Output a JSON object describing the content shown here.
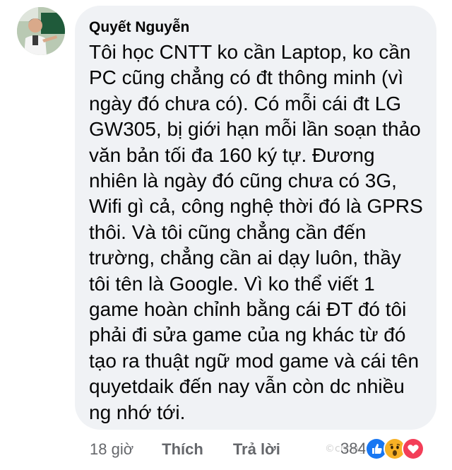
{
  "comment": {
    "author": "Quyết Nguyễn",
    "lines": [
      "Tôi học CNTT ko cần Laptop, ko cần",
      "PC cũng chẳng có đt thông minh (vì",
      "ngày đó chưa có). Có mỗi cái đt LG",
      "GW305, bị giới hạn mỗi lần soạn thảo",
      "văn bản tối đa 160 ký tự. Đương",
      "nhiên là ngày đó cũng chưa có 3G,",
      "Wifi gì cả, công nghệ thời đó là GPRS",
      "thôi. Và tôi cũng chẳng cần đến",
      "trường, chẳng cần ai dạy luôn, thầy",
      "tôi tên là Google. Vì ko thể viết 1",
      "game hoàn chỉnh bằng cái ĐT đó tôi",
      "phải đi sửa game của ng khác từ đó",
      "tạo ra thuật ngữ mod game và cái tên",
      "quyetdaik đến nay vẫn còn dc nhiều",
      "ng nhớ tới."
    ]
  },
  "actions": {
    "time": "18 giờ",
    "like_label": "Thích",
    "reply_label": "Trả lời"
  },
  "reactions": {
    "count": "384",
    "icons": [
      "like-icon",
      "wow-icon",
      "love-icon"
    ]
  },
  "watermark": "©chongchanhvn",
  "colors": {
    "bubble": "#f0f2f5",
    "text": "#050505",
    "secondary": "#65676b",
    "like_blue": "#1877f2",
    "wow_yellow": "#f7b125",
    "love_red": "#f33e58"
  }
}
